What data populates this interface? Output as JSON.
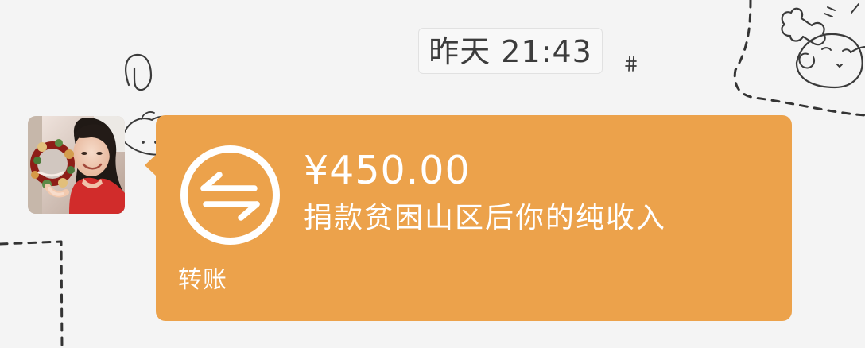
{
  "chat": {
    "timestamp": "昨天 21:43"
  },
  "message": {
    "sender_avatar": "avatar",
    "type": "transfer",
    "amount": "¥450.00",
    "description": "捐款贫困山区后你的纯收入",
    "footer_label": "转账",
    "icon": "transfer-arrows-icon",
    "bubble_color": "#eca24b"
  },
  "background": {
    "color": "#f4f4f4"
  }
}
